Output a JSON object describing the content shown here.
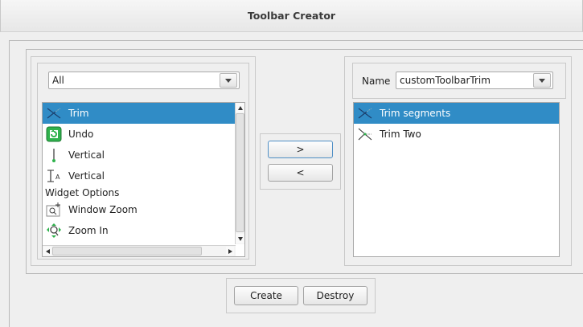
{
  "window": {
    "title": "Toolbar Creator"
  },
  "left_panel": {
    "filter_combo": {
      "value": "All"
    },
    "items": [
      {
        "label": "Trim",
        "icon": "trim-icon",
        "selected": true
      },
      {
        "label": "Undo",
        "icon": "undo-icon",
        "selected": false
      },
      {
        "label": "Vertical",
        "icon": "vertical-line-icon",
        "selected": false
      },
      {
        "label": "Vertical",
        "icon": "vertical-dimension-icon",
        "selected": false
      }
    ],
    "group_header": "Widget Options",
    "items2": [
      {
        "label": "Window Zoom",
        "icon": "window-zoom-icon"
      },
      {
        "label": "Zoom In",
        "icon": "zoom-in-icon"
      }
    ]
  },
  "move_buttons": {
    "add_label": ">",
    "remove_label": "<"
  },
  "right_panel": {
    "name_label": "Name",
    "name_combo": {
      "value": "customToolbarTrim"
    },
    "items": [
      {
        "label": "Trim segments",
        "icon": "trim-segments-icon",
        "selected": true
      },
      {
        "label": "Trim Two",
        "icon": "trim-two-icon",
        "selected": false
      }
    ]
  },
  "bottom_buttons": {
    "create_label": "Create",
    "destroy_label": "Destroy"
  },
  "colors": {
    "selection": "#308cc6",
    "background": "#efefef"
  }
}
